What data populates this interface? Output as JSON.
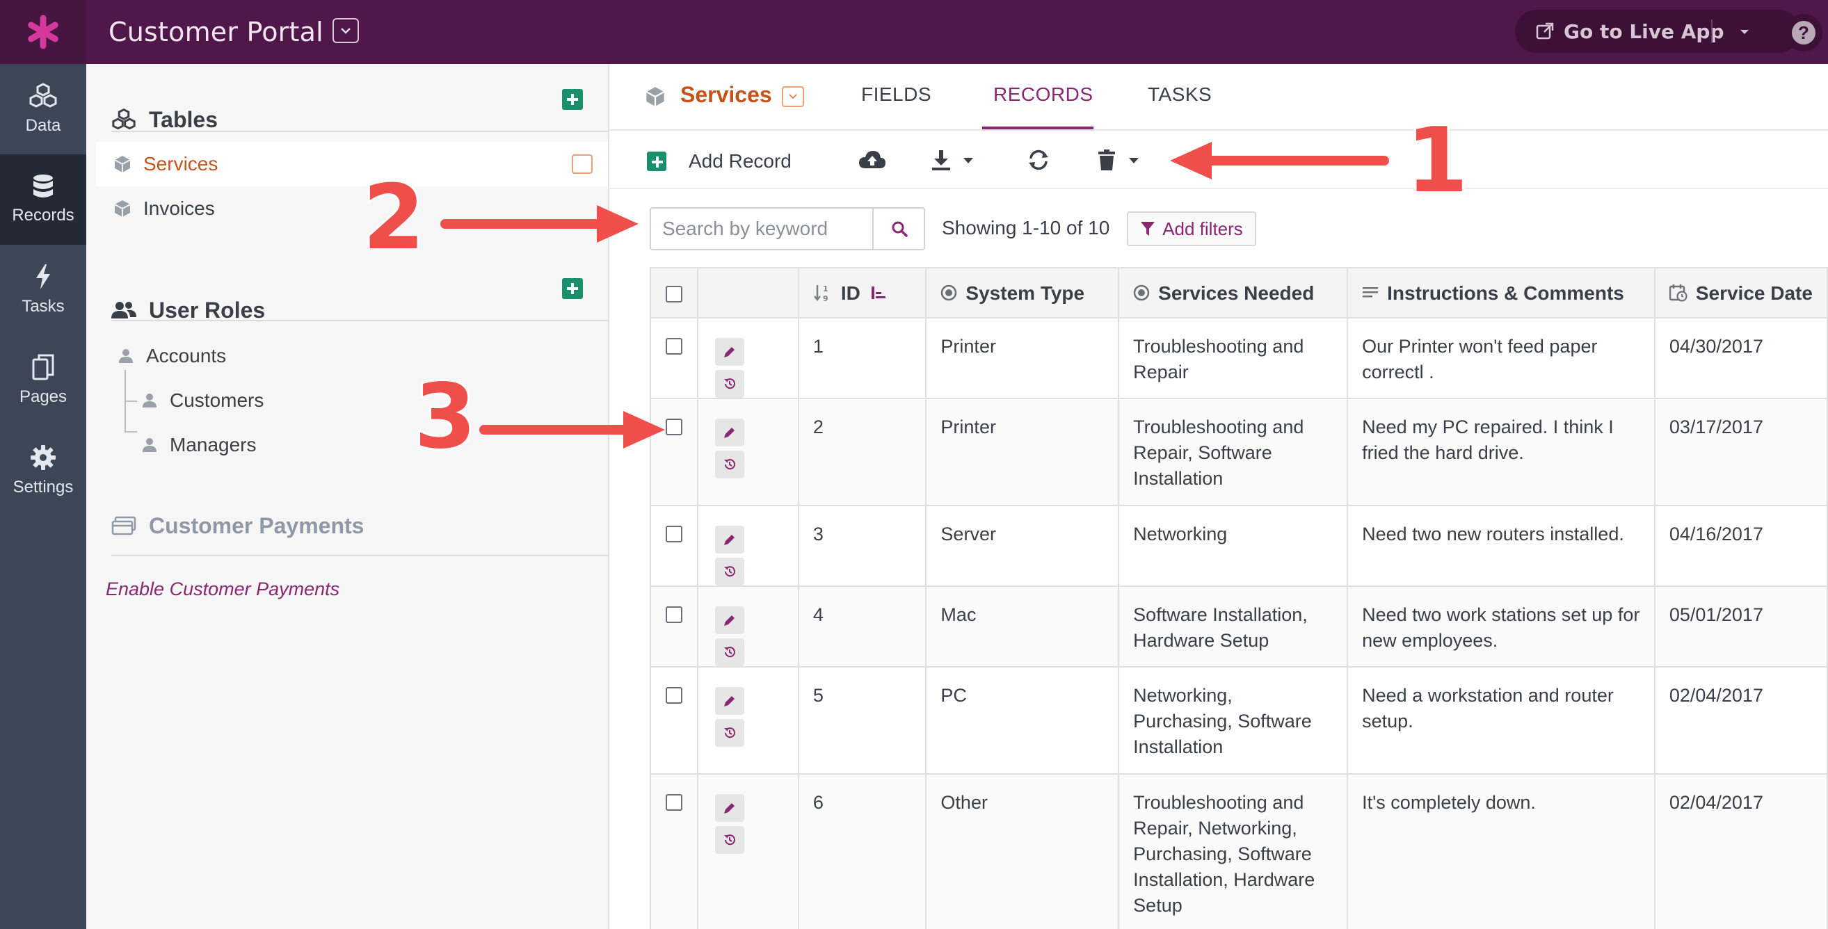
{
  "topbar": {
    "app_title": "Customer Portal",
    "live_app_label": "Go to Live App",
    "brand_color": "#50184a"
  },
  "rail": {
    "items": [
      {
        "label": "Data",
        "icon": "cubes-icon"
      },
      {
        "label": "Records",
        "icon": "database-icon",
        "active": true
      },
      {
        "label": "Tasks",
        "icon": "bolt-icon"
      },
      {
        "label": "Pages",
        "icon": "pages-icon"
      },
      {
        "label": "Settings",
        "icon": "gear-icon"
      }
    ]
  },
  "sidebar": {
    "tables_heading": "Tables",
    "tables": [
      "Services",
      "Invoices"
    ],
    "roles_heading": "User Roles",
    "roles": [
      "Accounts",
      "Customers",
      "Managers"
    ],
    "payments_heading": "Customer Payments",
    "payments_link": "Enable Customer Payments"
  },
  "main": {
    "object_title": "Services",
    "tabs": [
      "FIELDS",
      "RECORDS",
      "TASKS"
    ],
    "active_tab": "RECORDS",
    "add_record_label": "Add Record",
    "search_placeholder": "Search by keyword",
    "showing_text": "Showing 1-10 of 10",
    "add_filters_label": "Add filters",
    "accent_color": "#8a2672"
  },
  "table": {
    "columns": [
      "ID",
      "System Type",
      "Services Needed",
      "Instructions & Comments",
      "Service Date"
    ],
    "rows": [
      {
        "id": "1",
        "system_type": "Printer",
        "services": "Troubleshooting and Repair",
        "instructions": "Our Printer won't feed paper correctl .",
        "date": "04/30/2017"
      },
      {
        "id": "2",
        "system_type": "Printer",
        "services": "Troubleshooting and Repair, Software Installation",
        "instructions": "Need my PC repaired. I think I fried the hard drive.",
        "date": "03/17/2017"
      },
      {
        "id": "3",
        "system_type": "Server",
        "services": "Networking",
        "instructions": "Need two new routers installed.",
        "date": "04/16/2017"
      },
      {
        "id": "4",
        "system_type": "Mac",
        "services": "Software Installation, Hardware Setup",
        "instructions": "Need two work stations set up for new employees.",
        "date": "05/01/2017"
      },
      {
        "id": "5",
        "system_type": "PC",
        "services": "Networking, Purchasing, Software Installation",
        "instructions": "Need a workstation and router setup.",
        "date": "02/04/2017"
      },
      {
        "id": "6",
        "system_type": "Other",
        "services": "Troubleshooting and Repair, Networking, Purchasing, Software Installation, Hardware Setup",
        "instructions": "It's completely down.",
        "date": "02/04/2017"
      }
    ]
  },
  "annotations": {
    "labels": [
      "1",
      "2",
      "3"
    ],
    "arrow_color": "#ef4f4a"
  }
}
